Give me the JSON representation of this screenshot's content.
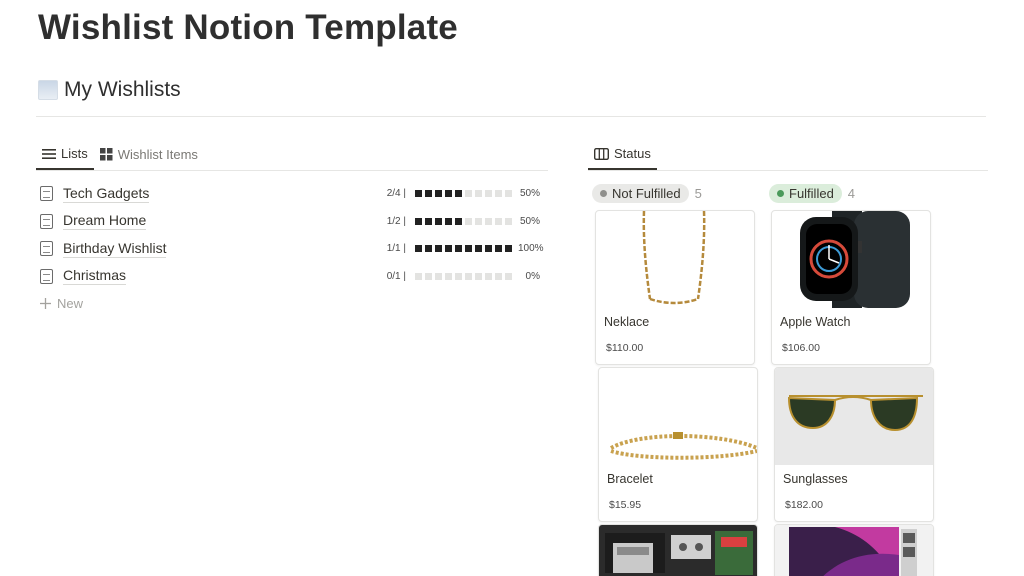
{
  "page": {
    "title": "Wishlist Notion Template"
  },
  "section": {
    "title": "My Wishlists"
  },
  "left_tabs": [
    {
      "label": "Lists",
      "icon": "list-icon",
      "active": true
    },
    {
      "label": "Wishlist Items",
      "icon": "gallery-icon",
      "active": false
    }
  ],
  "lists": [
    {
      "name": "Tech Gadgets",
      "fraction": "2/4 |",
      "filled": 5,
      "total": 10,
      "percent": "50%",
      "progress": 0.5
    },
    {
      "name": "Dream Home",
      "fraction": "1/2 |",
      "filled": 5,
      "total": 10,
      "percent": "50%",
      "progress": 0.5
    },
    {
      "name": "Birthday Wishlist",
      "fraction": "1/1 |",
      "filled": 10,
      "total": 10,
      "percent": "100%",
      "progress": 1.0
    },
    {
      "name": "Christmas",
      "fraction": "0/1 |",
      "filled": 0,
      "total": 10,
      "percent": "0%",
      "progress": 0.0
    }
  ],
  "new_label": "New",
  "right_tab": {
    "label": "Status",
    "icon": "board-icon"
  },
  "columns": [
    {
      "label": "Not Fulfilled",
      "count": "5",
      "color": "#e9e9e7",
      "dot": "#8f8f8c"
    },
    {
      "label": "Fulfilled",
      "count": "4",
      "color": "#dbeddb",
      "dot": "#4b9a5b"
    }
  ],
  "cards": {
    "not_fulfilled": [
      {
        "title": "Neklace",
        "price": "$110.00"
      },
      {
        "title": "Bracelet",
        "price": "$15.95"
      },
      {
        "title": "",
        "price": ""
      }
    ],
    "fulfilled": [
      {
        "title": "Apple Watch",
        "price": "$106.00"
      },
      {
        "title": "Sunglasses",
        "price": "$182.00"
      },
      {
        "title": "",
        "price": ""
      }
    ]
  },
  "colors": {
    "text": "#37352f",
    "progress_on": "#222222",
    "progress_off": "#e3e3e1"
  }
}
